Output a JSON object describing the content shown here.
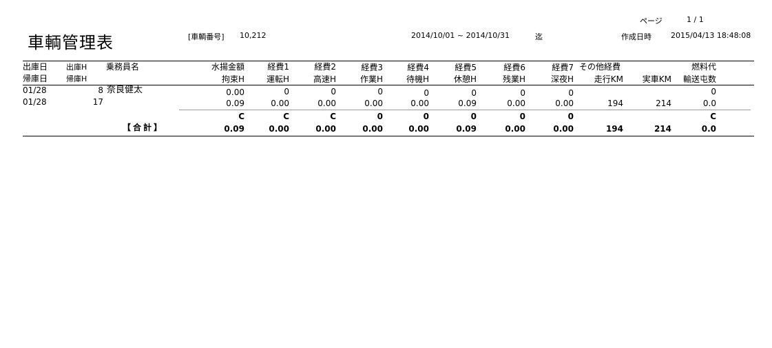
{
  "page": {
    "label": "ページ",
    "value": "1 / 1"
  },
  "title": "車輌管理表",
  "vehicle": {
    "label": "[車輌番号]",
    "value": "10,212"
  },
  "period": {
    "text": "2014/10/01 ~ 2014/10/31",
    "suffix": "迄"
  },
  "created": {
    "label": "作成日時",
    "value": "2015/04/13 18:48:08"
  },
  "headers1": [
    "出庫日",
    "出庫H",
    "乗務員名",
    "水揚金額",
    "経費1",
    "経費2",
    "経費3",
    "経費4",
    "経費5",
    "経費6",
    "経費7",
    "その他経費",
    "燃料代"
  ],
  "headers2": [
    "帰庫日",
    "帰庫H",
    "拘束H",
    "運転H",
    "高速H",
    "作業H",
    "待機H",
    "休憩H",
    "残業H",
    "深夜H",
    "走行KM",
    "実車KM",
    "輸送屯数"
  ],
  "rows": [
    {
      "date1": "01/28",
      "h1": "8",
      "name": "奈良健太",
      "top": [
        "0.00",
        "0",
        "0",
        "0",
        "0",
        "0",
        "0",
        "0",
        "",
        "0"
      ]
    },
    {
      "date1": "01/28",
      "h1": "17",
      "bottom": [
        "0.09",
        "0.00",
        "0.00",
        "0.00",
        "0.00",
        "0.09",
        "0.00",
        "0.00",
        "194",
        "214",
        "0.0"
      ]
    }
  ],
  "totals": {
    "label": "【合計】",
    "top": [
      "C",
      "C",
      "C",
      "0",
      "0",
      "0",
      "0",
      "0",
      "C"
    ],
    "bottom": [
      "0.09",
      "0.00",
      "0.00",
      "0.00",
      "0.00",
      "0.09",
      "0.00",
      "0.00",
      "194",
      "214",
      "0.0"
    ]
  }
}
